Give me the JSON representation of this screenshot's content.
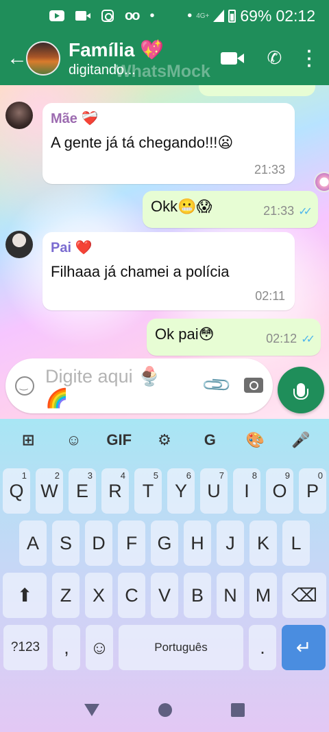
{
  "status_bar": {
    "battery": "69%",
    "time": "02:12",
    "network": "4G+"
  },
  "header": {
    "title": "Família 💖",
    "subtitle": "digitando...",
    "watermark": "WhatsMock"
  },
  "messages": [
    {
      "type": "in",
      "sender": "Mãe ❤️‍🩹",
      "sender_color": "#9c6bb0",
      "text": "A gente já tá chegando!!!😦",
      "time": "21:33"
    },
    {
      "type": "out",
      "text": "Okk😬😱",
      "time": "21:33"
    },
    {
      "type": "in",
      "sender": "Pai ❤️",
      "sender_color": "#7a6bd0",
      "text": "Filhaaa já chamei a polícia",
      "time": "02:11"
    },
    {
      "type": "out",
      "text": "Ok pai😳",
      "time": "02:12"
    }
  ],
  "input": {
    "placeholder": "Digite aqui 🍨 🌈"
  },
  "keyboard": {
    "toolbar": [
      "⊞",
      "☺",
      "GIF",
      "⚙",
      "G",
      "🎨",
      "🎤"
    ],
    "row1": [
      [
        "Q",
        "1"
      ],
      [
        "W",
        "2"
      ],
      [
        "E",
        "3"
      ],
      [
        "R",
        "4"
      ],
      [
        "T",
        "5"
      ],
      [
        "Y",
        "6"
      ],
      [
        "U",
        "7"
      ],
      [
        "I",
        "8"
      ],
      [
        "O",
        "9"
      ],
      [
        "P",
        "0"
      ]
    ],
    "row2": [
      "A",
      "S",
      "D",
      "F",
      "G",
      "H",
      "J",
      "K",
      "L"
    ],
    "row3": [
      "Z",
      "X",
      "C",
      "V",
      "B",
      "N",
      "M"
    ],
    "row4": {
      "symbols": "?123",
      "comma": ",",
      "emoji": "☺",
      "space": "Português",
      "period": ".",
      "enter": "↵"
    }
  }
}
